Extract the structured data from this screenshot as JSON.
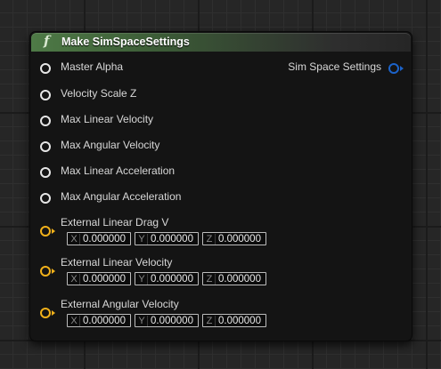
{
  "node": {
    "title": "Make SimSpaceSettings",
    "icon": "function-icon",
    "header_color": "#4e7a46"
  },
  "inputs": [
    {
      "label": "Master Alpha",
      "type": "float"
    },
    {
      "label": "Velocity Scale Z",
      "type": "float"
    },
    {
      "label": "Max Linear Velocity",
      "type": "float"
    },
    {
      "label": "Max Angular Velocity",
      "type": "float"
    },
    {
      "label": "Max Linear Acceleration",
      "type": "float"
    },
    {
      "label": "Max Angular Acceleration",
      "type": "float"
    },
    {
      "label": "External Linear Drag V",
      "type": "vector",
      "fields": [
        {
          "axis": "X",
          "value": "0.000000"
        },
        {
          "axis": "Y",
          "value": "0.000000"
        },
        {
          "axis": "Z",
          "value": "0.000000"
        }
      ]
    },
    {
      "label": "External Linear Velocity",
      "type": "vector",
      "fields": [
        {
          "axis": "X",
          "value": "0.000000"
        },
        {
          "axis": "Y",
          "value": "0.000000"
        },
        {
          "axis": "Z",
          "value": "0.000000"
        }
      ]
    },
    {
      "label": "External Angular Velocity",
      "type": "vector",
      "fields": [
        {
          "axis": "X",
          "value": "0.000000"
        },
        {
          "axis": "Y",
          "value": "0.000000"
        },
        {
          "axis": "Z",
          "value": "0.000000"
        }
      ]
    }
  ],
  "output": {
    "label": "Sim Space Settings",
    "type": "struct",
    "color": "#1c63c9"
  },
  "colors": {
    "float_pin": "#e6e6e6",
    "vector_pin": "#f2b11a"
  }
}
